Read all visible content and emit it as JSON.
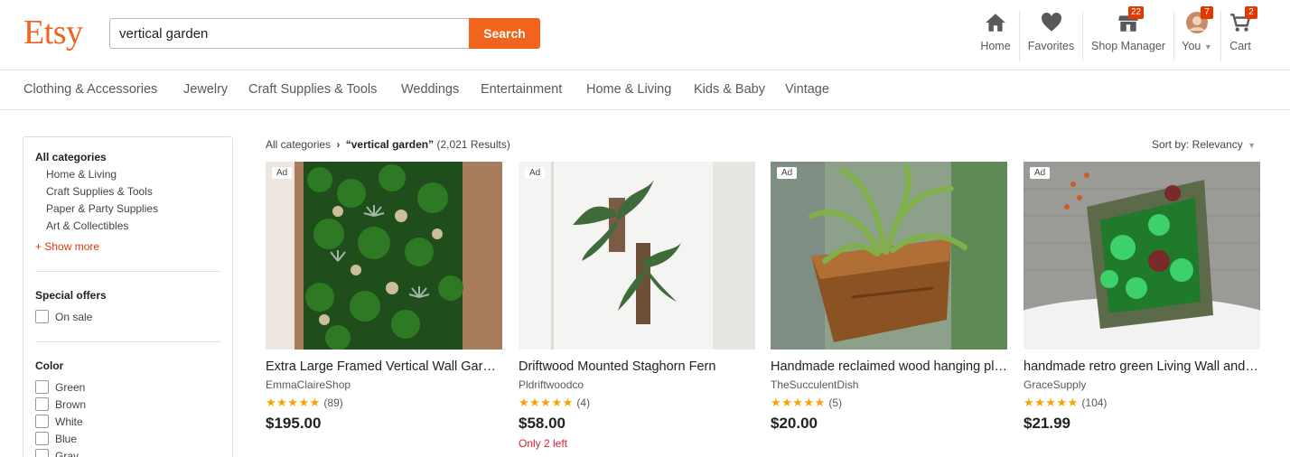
{
  "logo": "Etsy",
  "search": {
    "value": "vertical garden",
    "button": "Search"
  },
  "header_nav": [
    {
      "label": "Home",
      "icon": "home-icon"
    },
    {
      "label": "Favorites",
      "icon": "heart-icon"
    },
    {
      "label": "Shop Manager",
      "icon": "shop-icon",
      "badge": "22"
    },
    {
      "label": "You",
      "icon": "avatar",
      "badge": "7"
    },
    {
      "label": "Cart",
      "icon": "cart-icon",
      "badge": "2"
    }
  ],
  "categories": [
    "Clothing & Accessories",
    "Jewelry",
    "Craft Supplies & Tools",
    "Weddings",
    "Entertainment",
    "Home & Living",
    "Kids & Baby",
    "Vintage"
  ],
  "sidebar": {
    "all_categories": "All categories",
    "category_items": [
      "Home & Living",
      "Craft Supplies & Tools",
      "Paper & Party Supplies",
      "Art & Collectibles"
    ],
    "show_more": "+ Show more",
    "special_offers": "Special offers",
    "on_sale": "On sale",
    "color": "Color",
    "colors": [
      "Green",
      "Brown",
      "White",
      "Blue",
      "Gray"
    ]
  },
  "results": {
    "crumb_root": "All categories",
    "query": "“vertical garden”",
    "count": "(2,021 Results)",
    "sort": "Sort by: Relevancy"
  },
  "listings": [
    {
      "ad": "Ad",
      "title": "Extra Large Framed Vertical Wall Garden",
      "shop": "EmmaClaireShop",
      "stars": "★★★★★",
      "rating": 5,
      "reviews": "(89)",
      "price": "$195.00",
      "note": ""
    },
    {
      "ad": "Ad",
      "title": "Driftwood Mounted Staghorn Fern",
      "shop": "Pldriftwoodco",
      "stars": "★★★★★",
      "rating": 5,
      "reviews": "(4)",
      "price": "$58.00",
      "note": "Only 2 left"
    },
    {
      "ad": "Ad",
      "title": "Handmade reclaimed wood hanging planter",
      "shop": "TheSucculentDish",
      "stars": "★★★★★",
      "rating": 5,
      "reviews": "(5)",
      "price": "$20.00",
      "note": ""
    },
    {
      "ad": "Ad",
      "title": "handmade retro green Living Wall and succulents",
      "shop": "GraceSupply",
      "stars": "★★★★★",
      "rating": 5,
      "reviews": "(104)",
      "price": "$21.99",
      "note": ""
    }
  ],
  "colors": {
    "brand": "#f1641e",
    "badge": "#e03a00",
    "star": "#f7a400",
    "alert": "#d4202c"
  }
}
